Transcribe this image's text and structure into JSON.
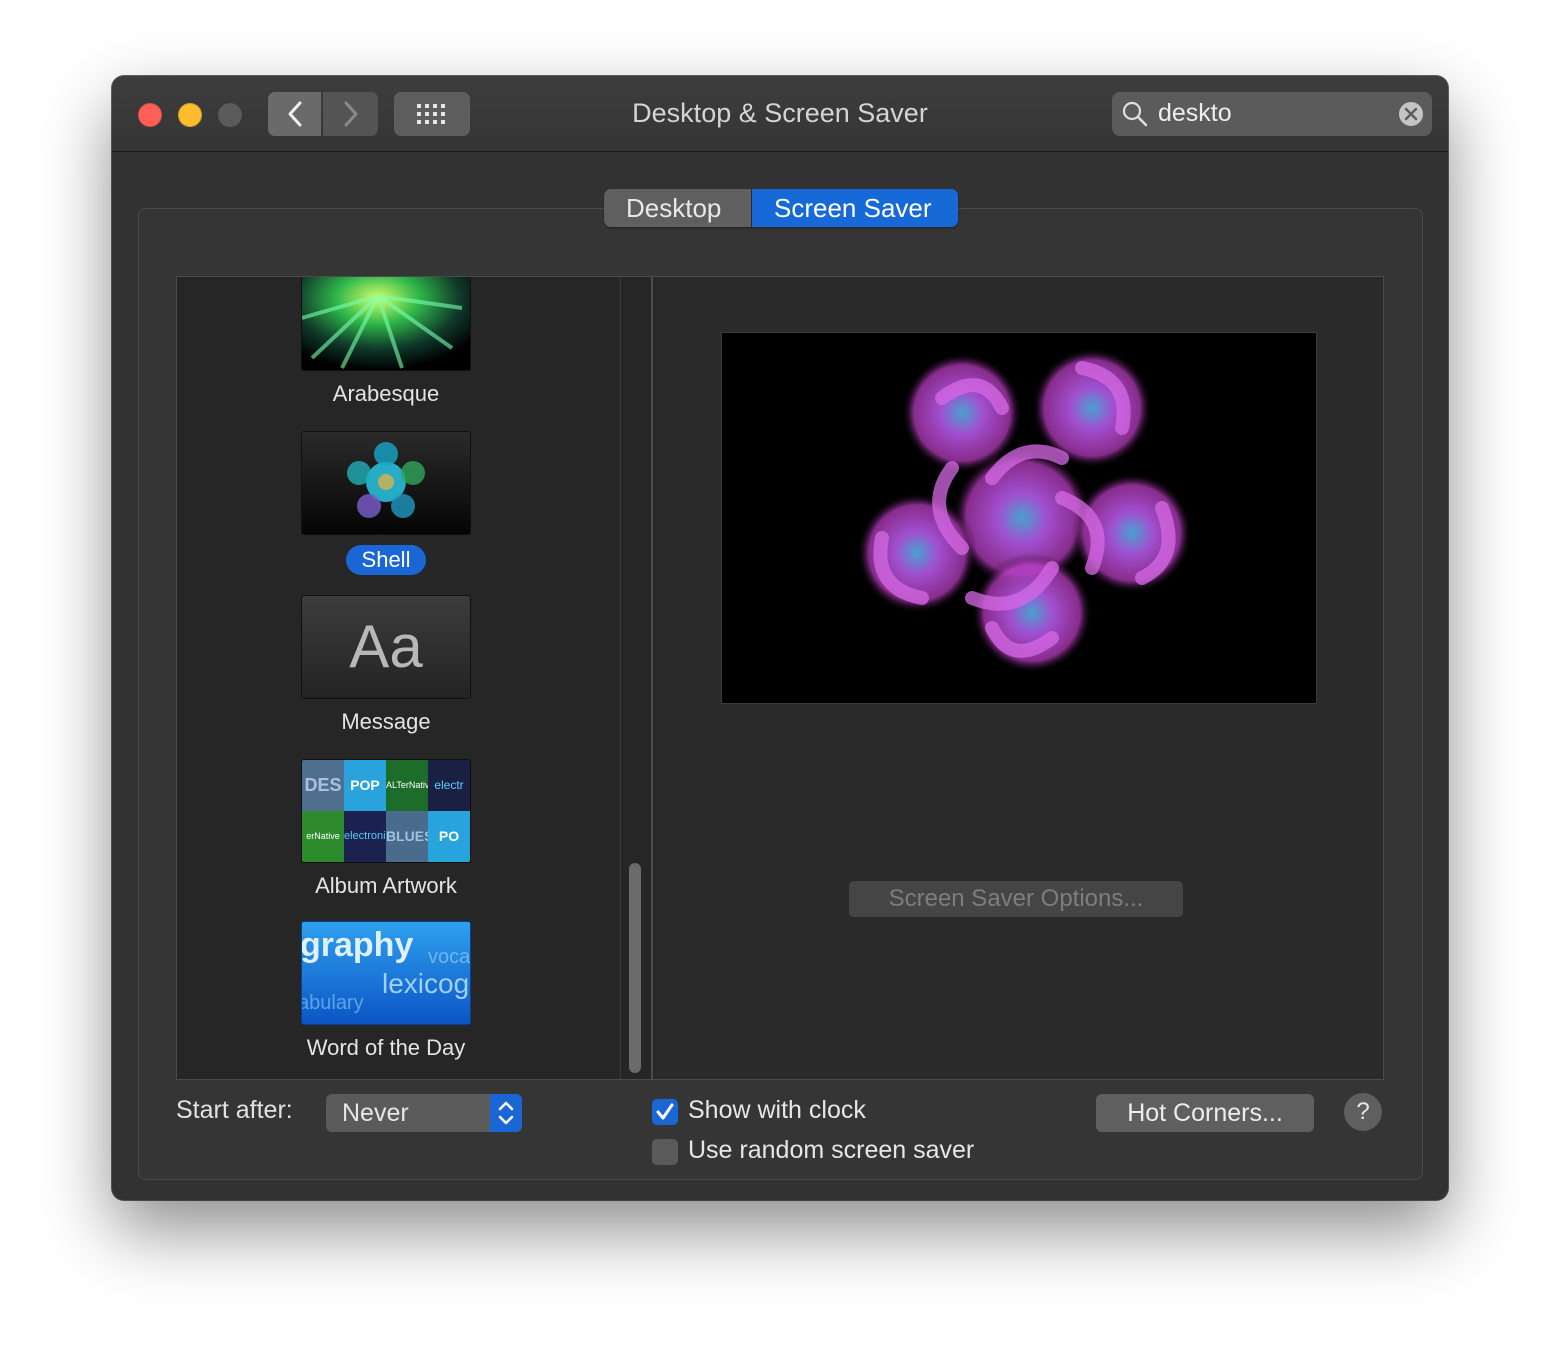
{
  "window": {
    "title": "Desktop & Screen Saver"
  },
  "search": {
    "value": "deskto"
  },
  "tabs": {
    "desktop": "Desktop",
    "screen_saver": "Screen Saver",
    "selected": "Screen Saver"
  },
  "savers": [
    {
      "label": "Arabesque",
      "selected": false
    },
    {
      "label": "Shell",
      "selected": true
    },
    {
      "label": "Message",
      "selected": false,
      "thumb_text": "Aa"
    },
    {
      "label": "Album Artwork",
      "selected": false
    },
    {
      "label": "Word of the Day",
      "selected": false,
      "thumb_words": [
        "graphy",
        "voca",
        "lexicog",
        "abulary"
      ]
    }
  ],
  "album_thumb_text": [
    "DES",
    "POP",
    "ALTerNative",
    "electr",
    "erNative",
    "electronic",
    "BLUES",
    "PO"
  ],
  "options_button": "Screen Saver Options...",
  "start_after": {
    "label": "Start after:",
    "value": "Never"
  },
  "show_with_clock": {
    "label": "Show with clock",
    "checked": true
  },
  "random_saver": {
    "label": "Use random screen saver",
    "checked": false
  },
  "hot_corners_button": "Hot Corners...",
  "help_button": "?",
  "colors": {
    "accent": "#1a66d5",
    "close": "#ff5f57",
    "minimize": "#febc2e"
  }
}
